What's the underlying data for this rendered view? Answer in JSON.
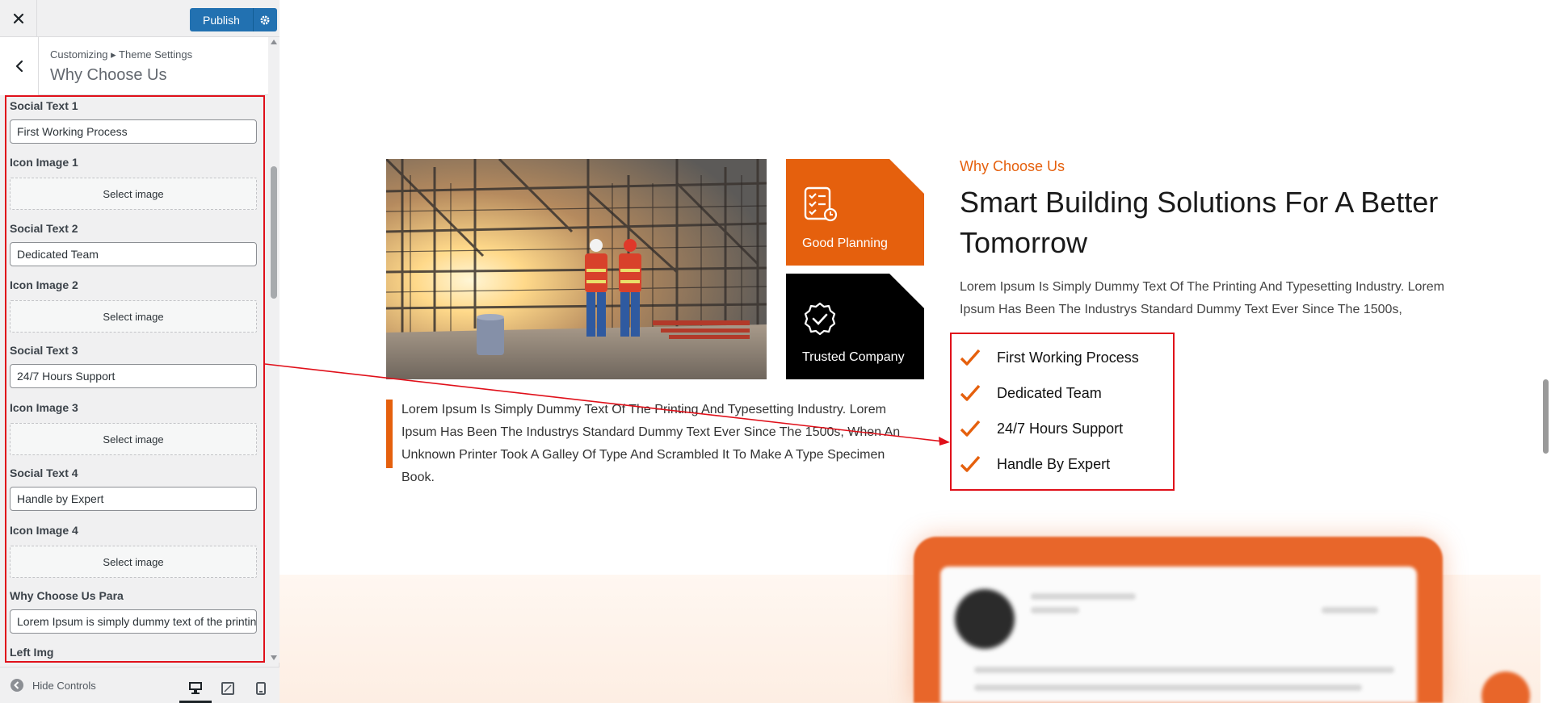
{
  "topbar": {
    "publish_label": "Publish"
  },
  "section": {
    "breadcrumb": "Customizing ▸ Theme Settings",
    "title": "Why Choose Us"
  },
  "controls": [
    {
      "label": "Social Text 1",
      "type": "text",
      "value": "First Working Process"
    },
    {
      "label": "Icon Image 1",
      "type": "image",
      "button": "Select image"
    },
    {
      "label": "Social Text 2",
      "type": "text",
      "value": "Dedicated Team"
    },
    {
      "label": "Icon Image 2",
      "type": "image",
      "button": "Select image"
    },
    {
      "label": "Social Text 3",
      "type": "text",
      "value": "24/7 Hours Support"
    },
    {
      "label": "Icon Image 3",
      "type": "image",
      "button": "Select image"
    },
    {
      "label": "Social Text 4",
      "type": "text",
      "value": "Handle by Expert"
    },
    {
      "label": "Icon Image 4",
      "type": "image",
      "button": "Select image"
    },
    {
      "label": "Why Choose Us Para",
      "type": "text",
      "value": "Lorem Ipsum is simply dummy text of the printing"
    },
    {
      "label": "Left Img",
      "type": "label"
    }
  ],
  "footer": {
    "hide_controls": "Hide Controls"
  },
  "preview": {
    "boxes": {
      "orange_label": "Good Planning",
      "black_label": "Trusted Company"
    },
    "quote": "Lorem Ipsum Is Simply Dummy Text Of The Printing And Typesetting Industry. Lorem Ipsum Has Been The Industrys Standard Dummy Text Ever Since The 1500s, When An Unknown Printer Took A Galley Of Type And Scrambled It To Make A Type Specimen Book.",
    "eyebrow": "Why Choose Us",
    "headline": "Smart Building Solutions For A Better Tomorrow",
    "lead": "Lorem Ipsum Is Simply Dummy Text Of The Printing And Typesetting Industry. Lorem Ipsum Has Been The Industrys Standard Dummy Text Ever Since The 1500s,",
    "features": [
      "First Working Process",
      "Dedicated Team",
      "24/7 Hours Support",
      "Handle By Expert"
    ]
  },
  "colors": {
    "accent": "#e5600d",
    "wp_blue": "#2271b1",
    "annotation_red": "#e0101a"
  }
}
